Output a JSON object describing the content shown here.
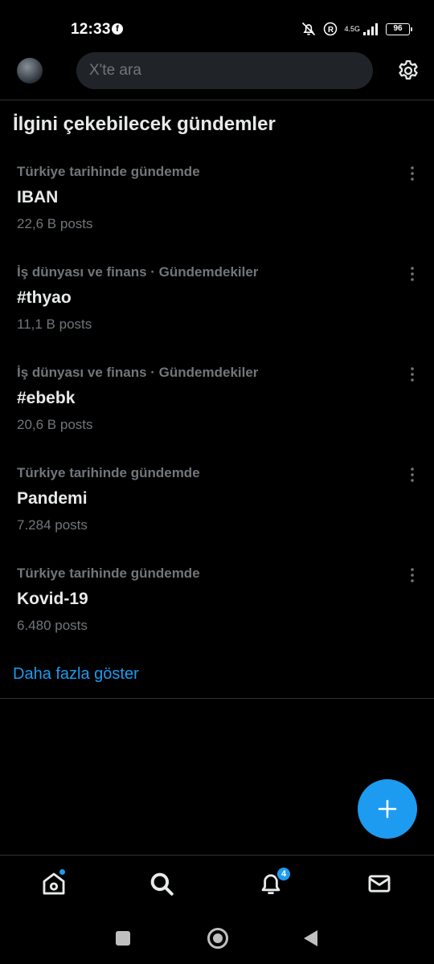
{
  "status_bar": {
    "time": "12:33",
    "app_notification_icon": "facebook-icon",
    "network_label": "4.5G",
    "battery": "96"
  },
  "header": {
    "avatar_icon": "profile-avatar",
    "search_placeholder": "X'te ara",
    "settings_icon": "gear-icon"
  },
  "section": {
    "title": "İlgini çekebilecek gündemler"
  },
  "trends": [
    {
      "context": "Türkiye tarihinde gündemde",
      "name": "IBAN",
      "count": "22,6 B posts"
    },
    {
      "context": "İş dünyası ve finans · Gündemdekiler",
      "name": "#thyao",
      "count": "11,1 B posts"
    },
    {
      "context": "İş dünyası ve finans · Gündemdekiler",
      "name": "#ebebk",
      "count": "20,6 B posts"
    },
    {
      "context": "Türkiye tarihinde gündemde",
      "name": "Pandemi",
      "count": "7.284 posts"
    },
    {
      "context": "Türkiye tarihinde gündemde",
      "name": "Kovid-19",
      "count": "6.480 posts"
    }
  ],
  "show_more": "Daha fazla göster",
  "fab": {
    "icon": "plus-icon"
  },
  "bottom_nav": {
    "items": [
      {
        "icon": "home-icon"
      },
      {
        "icon": "search-icon"
      },
      {
        "icon": "bell-icon",
        "badge": "4"
      },
      {
        "icon": "mail-icon"
      }
    ]
  },
  "colors": {
    "accent": "#1d9bf0",
    "background": "#000000",
    "text_primary": "#e7e9ea",
    "text_secondary": "#71767b",
    "divider": "#2f3336"
  }
}
